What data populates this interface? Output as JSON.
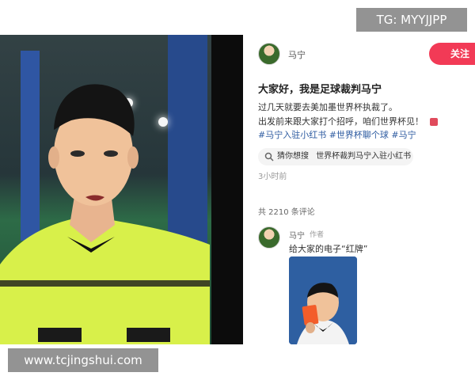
{
  "header": {
    "username": "马宁",
    "follow_label": "关注"
  },
  "post": {
    "title": "大家好，我是足球裁判马宁",
    "lines": [
      "过几天就要去美加墨世界杯执裁了。",
      "出发前来跟大家打个招呼，咱们世界杯见！"
    ],
    "hashtags": "#马宁入驻小红书 #世界杯聊个球 #马宁",
    "search_suggestion": {
      "prefix": "猜你想搜",
      "query": "世界杯裁判马宁入驻小红书"
    },
    "time": "3小时前"
  },
  "comments": {
    "count_text": "共 2210 条评论",
    "items": [
      {
        "username": "马宁",
        "tag": "作者",
        "text": "给大家的电子“红牌”"
      }
    ]
  },
  "watermarks": {
    "top_right": "TG: MYYJJPP",
    "bottom_left": "www.tcjingshui.com"
  },
  "colors": {
    "accent": "#f23a56",
    "link": "#2c5aa0",
    "card_bg": "#2e5fa1"
  },
  "icons": [
    "search-icon"
  ]
}
